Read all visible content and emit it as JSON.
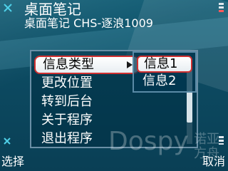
{
  "header": {
    "title": "桌面笔记",
    "subtitle": "桌面笔记 CHS-逐浪1009"
  },
  "menu": {
    "items": [
      {
        "label": "信息类型",
        "has_submenu": true,
        "selected": true
      },
      {
        "label": "更改位置"
      },
      {
        "label": "转到后台"
      },
      {
        "label": "关于程序"
      },
      {
        "label": "退出程序"
      }
    ]
  },
  "submenu": {
    "items": [
      {
        "label": "信息1",
        "selected": true
      },
      {
        "label": "信息2"
      }
    ]
  },
  "softkeys": {
    "left": "选择",
    "right": "取消"
  },
  "watermark": {
    "brand": "Dospy",
    "side_text": "诺亚\n方舟"
  },
  "colors": {
    "background": "#0c4a61",
    "highlight_border": "#d03030",
    "text": "#ffffff",
    "selected_text": "#000000"
  },
  "icons": {
    "top_left": "close-x-icon",
    "top_right": "signal-level-icon",
    "bottom_left": "close-x-icon",
    "bottom_right": "battery-level-icon"
  }
}
